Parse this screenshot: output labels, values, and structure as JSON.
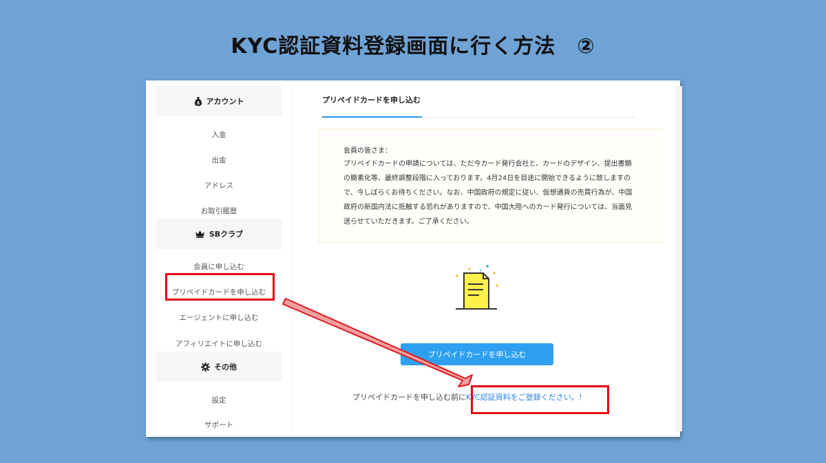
{
  "slide": {
    "title": "KYC認証資料登録画面に行く方法　②"
  },
  "sidebar": {
    "sections": [
      {
        "icon": "money-bag-icon",
        "label": "アカウント"
      },
      {
        "icon": "crown-icon",
        "label": "SBクラブ"
      },
      {
        "icon": "gear-icon",
        "label": "その他"
      }
    ],
    "items": [
      {
        "label": "入金"
      },
      {
        "label": "出金"
      },
      {
        "label": "アドレス"
      },
      {
        "label": "お取引履歴"
      },
      {
        "label": "会員に申し込む"
      },
      {
        "label": "プリペイドカードを申し込む"
      },
      {
        "label": "エージェントに申し込む"
      },
      {
        "label": "アフィリエイトに申し込む"
      },
      {
        "label": "設定"
      },
      {
        "label": "サポート"
      }
    ]
  },
  "main": {
    "tab_label": "プリペイドカードを申し込む",
    "notice": {
      "title": "会員の皆さま：",
      "lines": [
        "プリペイドカードの申請については、ただ今カード発行会社と、カードのデザイン、提出書類",
        "の簡素化等、最終調整段階に入っております。4月24日を目途に開始できるように致しますの",
        "で、今しばらくお待ちください。なお、中国政府の規定に従い、仮想通貨の売買行為が、中国",
        "政府の新国内法に抵触する恐れがありますので、中国大陸へのカード発行については、当面見",
        "送らせていただきます。ご了承ください。"
      ]
    },
    "document_icon": "document-icon",
    "apply_button": "プリペイドカードを申し込む",
    "kyc_prefix": "プリペイドカードを申し込む前に",
    "kyc_link": "KYC認証資料をご登録ください。！"
  },
  "colors": {
    "accent": "#2ea0f2",
    "highlight": "#e60012",
    "background": "#6fa3d6"
  }
}
